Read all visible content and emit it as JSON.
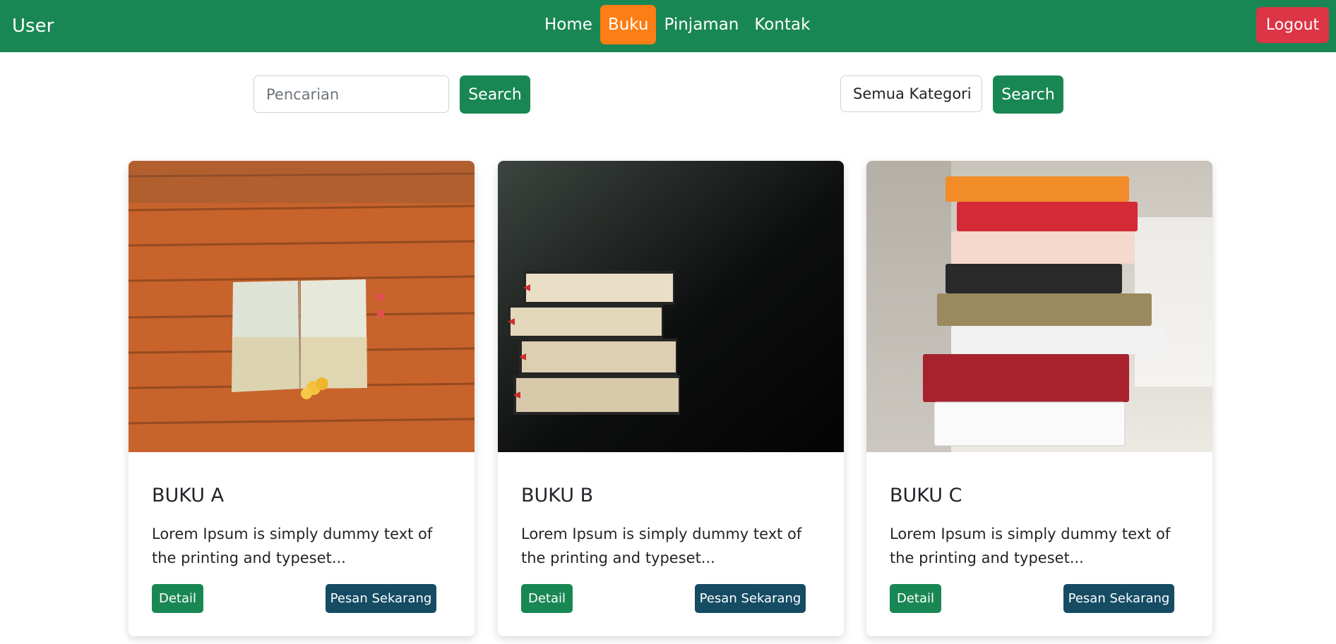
{
  "navbar": {
    "brand": "User",
    "links": [
      {
        "label": "Home",
        "active": false
      },
      {
        "label": "Buku",
        "active": true
      },
      {
        "label": "Pinjaman",
        "active": false
      },
      {
        "label": "Kontak",
        "active": false
      }
    ],
    "logout_label": "Logout"
  },
  "search": {
    "placeholder": "Pencarian",
    "value": "",
    "button_label": "Search"
  },
  "category": {
    "selected": "Semua Kategori",
    "button_label": "Search"
  },
  "cards": [
    {
      "title": "BUKU A",
      "description": "Lorem Ipsum is simply dummy text of the printing and typeset...",
      "detail_label": "Detail",
      "order_label": "Pesan Sekarang"
    },
    {
      "title": "BUKU B",
      "description": "Lorem Ipsum is simply dummy text of the printing and typeset...",
      "detail_label": "Detail",
      "order_label": "Pesan Sekarang"
    },
    {
      "title": "BUKU C",
      "description": "Lorem Ipsum is simply dummy text of the printing and typeset...",
      "detail_label": "Detail",
      "order_label": "Pesan Sekarang"
    }
  ],
  "colors": {
    "primary": "#198754",
    "active_nav": "#fd7e14",
    "danger": "#dc3545",
    "order_button": "#154c64"
  }
}
